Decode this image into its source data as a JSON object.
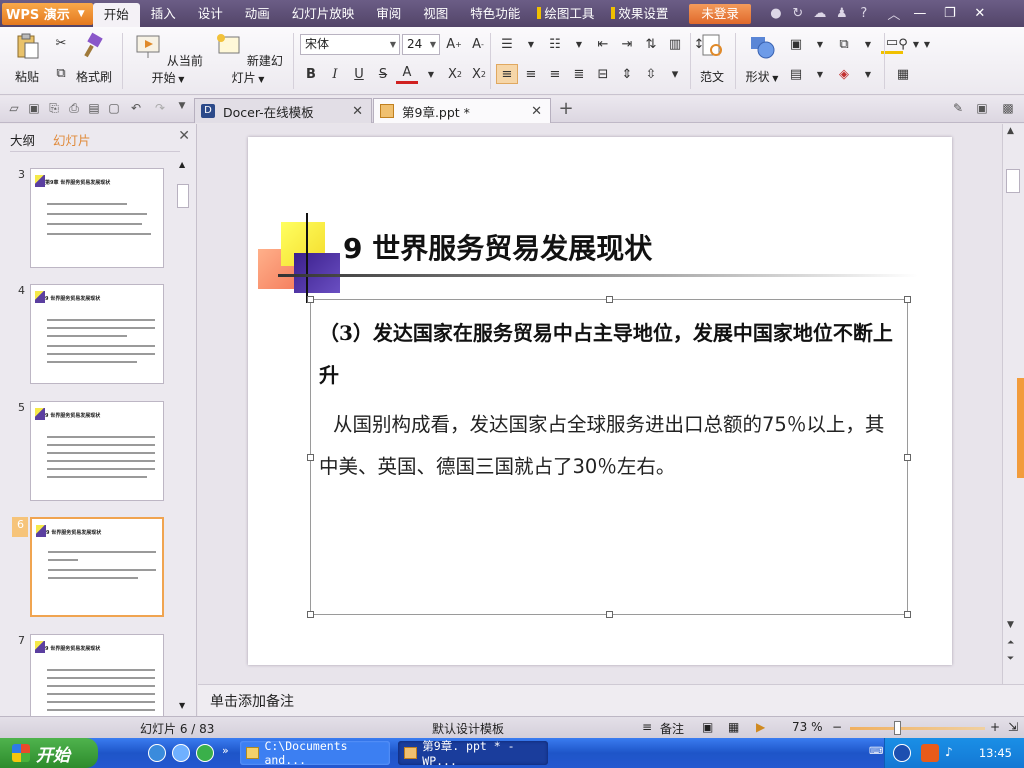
{
  "app": {
    "logo_text": "WPS 演示",
    "logo_arrow": "▼"
  },
  "menu": {
    "items": [
      "开始",
      "插入",
      "设计",
      "动画",
      "幻灯片放映",
      "审阅",
      "视图",
      "特色功能"
    ],
    "tool_items": [
      "绘图工具",
      "效果设置"
    ],
    "login": "未登录"
  },
  "ribbon": {
    "paste": "粘贴",
    "format_painter": "格式刷",
    "from_current": "从当前开始",
    "new_slide": "新建幻灯片",
    "font_name": "宋体",
    "font_size": "24",
    "template": "范文",
    "shape": "形状"
  },
  "tabs": {
    "docer": "Docer-在线模板",
    "doc": "第9章.ppt *"
  },
  "left_panel": {
    "tab_outline": "大纲",
    "tab_slides": "幻灯片",
    "thumbs": [
      {
        "num": "3",
        "title": "第9章 世界服务贸易发展现状"
      },
      {
        "num": "4",
        "title": "9 世界服务贸易发展现状"
      },
      {
        "num": "5",
        "title": "9 世界服务贸易发展现状"
      },
      {
        "num": "6",
        "title": "9 世界服务贸易发展现状"
      },
      {
        "num": "7",
        "title": "9 世界服务贸易发展现状"
      }
    ]
  },
  "slide": {
    "title": "9 世界服务贸易发展现状",
    "heading": "（3）发达国家在服务贸易中占主导地位，发展中国家地位不断上升",
    "body": "从国别构成看，发达国家占全球服务进出口总额的75％以上，其中美、英国、德国三国就占了30％左右。"
  },
  "notes": {
    "placeholder": "单击添加备注"
  },
  "status": {
    "slide_pos": "幻灯片 6 / 83",
    "design": "默认设计模板",
    "notes": "备注",
    "zoom": "73 %"
  },
  "taskbar": {
    "start": "开始",
    "tasks": [
      "C:\\Documents and...",
      "第9章. ppt * - WP..."
    ],
    "time": "13:45"
  },
  "colors": {
    "menubar": "#5e4f79",
    "accent_orange": "#f29c3c",
    "taskbar": "#2458d0"
  }
}
